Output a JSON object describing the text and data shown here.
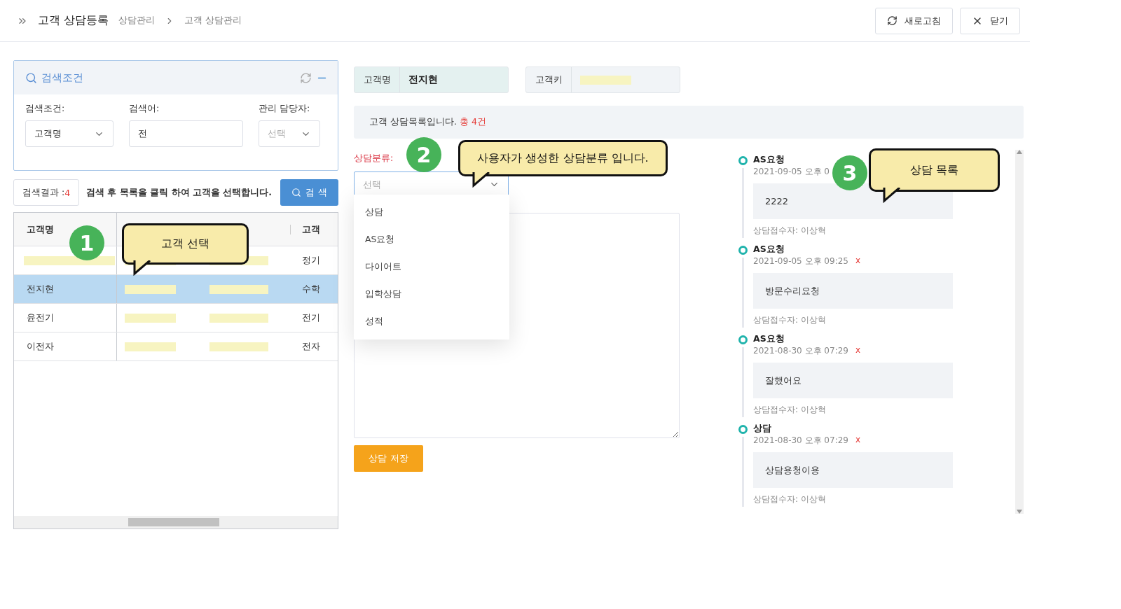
{
  "header": {
    "title": "고객 상담등록",
    "breadcrumb": [
      "상담관리",
      "고객 상담관리"
    ],
    "buttons": [
      {
        "kind": "refresh",
        "label": "새로고침"
      },
      {
        "kind": "close",
        "label": "닫기"
      }
    ]
  },
  "search_panel": {
    "title": "검색조건",
    "fields": [
      {
        "kind": "select",
        "label": "검색조건:",
        "value": "고객명"
      },
      {
        "kind": "input",
        "label": "검색어:",
        "value": "전"
      },
      {
        "kind": "select",
        "label": "관리 담당자:",
        "placeholder": "선택"
      }
    ]
  },
  "result": {
    "label": "검색결과 : ",
    "count": "4",
    "hint": "검색 후 목록을 클릭 하여 고객을 선택합니다.",
    "button": "검 색"
  },
  "table": {
    "columns": [
      "고객명",
      "고객"
    ],
    "rows": [
      {
        "name": "",
        "column_3": "정기",
        "selected": false
      },
      {
        "name": "전지현",
        "column_3": "수학",
        "selected": true
      },
      {
        "name": "윤전기",
        "column_3": "전기",
        "selected": false
      },
      {
        "name": "이전자",
        "column_3": "전자",
        "selected": false
      }
    ]
  },
  "customer": {
    "name_label": "고객명",
    "name": "전지현",
    "key_label": "고객키"
  },
  "banner": {
    "text": "고객 상담목록입니다. ",
    "total": "총 4건"
  },
  "category": {
    "label": "상담분류:",
    "placeholder": "선택",
    "expanded": true,
    "options": [
      "상담",
      "AS요청",
      "다이어트",
      "입학상담",
      "성적"
    ]
  },
  "save_button": "상담 저장",
  "timeline": [
    {
      "type": "AS요청",
      "date": "2021-09-05 오후 0",
      "body": "2222",
      "receiver": "상담접수자: 이상혁"
    },
    {
      "type": "AS요청",
      "date": "2021-09-05 오후 09:25",
      "delete": "x",
      "body": "방문수리요청",
      "receiver": "상담접수자: 이상혁"
    },
    {
      "type": "AS요청",
      "date": "2021-08-30 오후 07:29",
      "delete": "x",
      "body": "잘했어요",
      "receiver": "상담접수자: 이상혁"
    },
    {
      "type": "상담",
      "date": "2021-08-30 오후 07:29",
      "delete": "x",
      "body": "상담용청이용",
      "receiver": "상담접수자: 이상혁"
    }
  ],
  "annotations": [
    {
      "number": "1",
      "text": "고객 선택"
    },
    {
      "number": "2",
      "text": "사용자가 생성한 상담분류 입니다."
    },
    {
      "number": "3",
      "text": "상담 목록"
    }
  ]
}
